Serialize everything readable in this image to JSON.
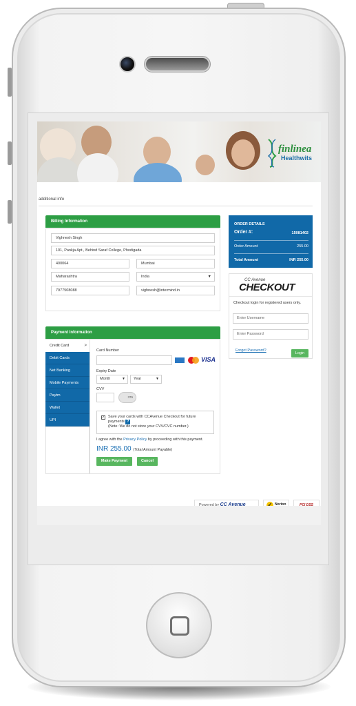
{
  "banner": {
    "brand_name": "finlinea",
    "brand_sub": "Healthwits"
  },
  "page": {
    "additional_info": "additional info"
  },
  "billing": {
    "header": "Billing Information",
    "name": "Vighnesh Singh",
    "address": "101, Pankja Apt., Behind Saraf College, Phodigada",
    "zip": "400064",
    "city": "Mumbai",
    "state": "Maharashtra",
    "country": "India",
    "phone": "7977508088",
    "email": "vighnesh@intermind.in"
  },
  "order": {
    "title": "ORDER DETAILS",
    "order_no_label": "Order #:",
    "order_no_value": "15081402",
    "amount_label": "Order Amount",
    "amount_value": "255.00",
    "total_label": "Total Amount",
    "total_value": "INR 255.00"
  },
  "checkout": {
    "logo_top": "CC Avenue",
    "logo": "CHECKOUT",
    "text": "Checkout login for registered users only.",
    "username_placeholder": "Enter Username",
    "password_placeholder": "Enter Password",
    "forgot": "Forgot Password?",
    "login": "Login"
  },
  "payment": {
    "header": "Payment Information",
    "tabs": [
      {
        "label": "Credit Card"
      },
      {
        "label": "Debit Cards"
      },
      {
        "label": "Net Banking"
      },
      {
        "label": "Mobile Payments"
      },
      {
        "label": "Paytm"
      },
      {
        "label": "Wallet"
      },
      {
        "label": "UPI"
      }
    ],
    "tab_chevron": ">",
    "card_number_label": "Card Number",
    "expiry_label": "Expiry Date",
    "month": "Month",
    "year": "Year",
    "cvv_label": "CVV",
    "cvv_icon_text": "376",
    "card_brand_visa": "VISA",
    "save_text": "Save your cards with CCAvenue Checkout for future payments",
    "save_note": "(Note: We do not store your CVV/CVC number.)",
    "agree_prefix": "I agree with the ",
    "privacy_link": "Privacy Policy",
    "agree_suffix": " by proceeding with this payment.",
    "amount": "INR 255.00",
    "amount_note": "(Total Amount Payable)",
    "make_payment": "Make Payment",
    "cancel": "Cancel"
  },
  "footer": {
    "powered_by": "Powered by",
    "powered_brand": "CC Avenue",
    "norton": "Norton",
    "pci": "PCI DSS"
  },
  "colors": {
    "green": "#2d9e44",
    "blue": "#1169a8",
    "link": "#1a6fb3"
  }
}
